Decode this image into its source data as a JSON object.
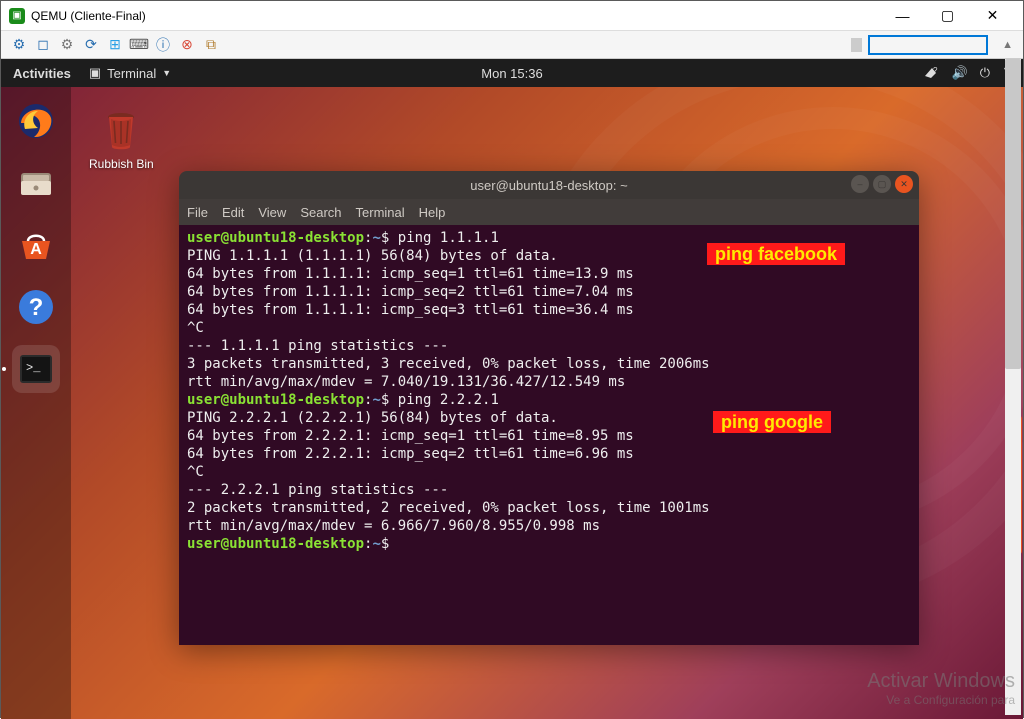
{
  "window": {
    "title": "QEMU (Cliente-Final)",
    "controls": {
      "minimize": "—",
      "maximize": "▢",
      "close": "✕"
    }
  },
  "ubuntu_top": {
    "activities": "Activities",
    "terminal_label": "Terminal",
    "clock": "Mon 15:36"
  },
  "desktop_icons": {
    "trash_label": "Rubbish Bin"
  },
  "terminal_window": {
    "title": "user@ubuntu18-desktop: ~",
    "menu": [
      "File",
      "Edit",
      "View",
      "Search",
      "Terminal",
      "Help"
    ]
  },
  "terminal": {
    "prompt_user": "user@ubuntu18-desktop",
    "prompt_path": "~",
    "cmd1": "ping 1.1.1.1",
    "out1": [
      "PING 1.1.1.1 (1.1.1.1) 56(84) bytes of data.",
      "64 bytes from 1.1.1.1: icmp_seq=1 ttl=61 time=13.9 ms",
      "64 bytes from 1.1.1.1: icmp_seq=2 ttl=61 time=7.04 ms",
      "64 bytes from 1.1.1.1: icmp_seq=3 ttl=61 time=36.4 ms",
      "^C",
      "--- 1.1.1.1 ping statistics ---",
      "3 packets transmitted, 3 received, 0% packet loss, time 2006ms",
      "rtt min/avg/max/mdev = 7.040/19.131/36.427/12.549 ms"
    ],
    "cmd2": "ping 2.2.2.1",
    "out2": [
      "PING 2.2.2.1 (2.2.2.1) 56(84) bytes of data.",
      "64 bytes from 2.2.2.1: icmp_seq=1 ttl=61 time=8.95 ms",
      "64 bytes from 2.2.2.1: icmp_seq=2 ttl=61 time=6.96 ms",
      "^C",
      "--- 2.2.2.1 ping statistics ---",
      "2 packets transmitted, 2 received, 0% packet loss, time 1001ms",
      "rtt min/avg/max/mdev = 6.966/7.960/8.955/0.998 ms"
    ],
    "dollar": "$"
  },
  "annotations": {
    "a1": "ping facebook",
    "a2": "ping google"
  },
  "watermark": {
    "line1": "Activar Windows",
    "line2": "Ve a Configuración para"
  }
}
